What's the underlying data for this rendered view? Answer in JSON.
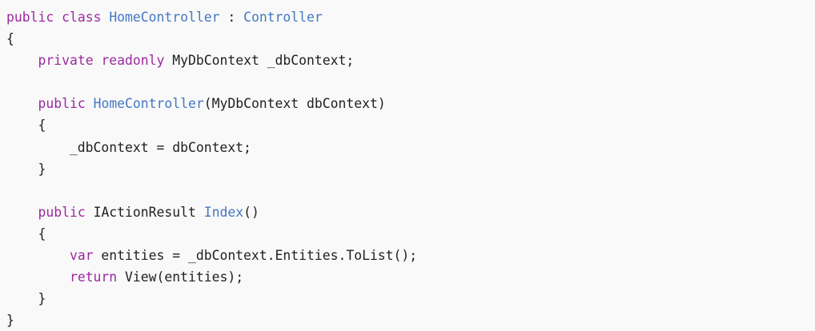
{
  "code": {
    "language": "csharp",
    "colors": {
      "background": "#f9f9f9",
      "keyword": "#9a2a9f",
      "type": "#4477c4",
      "function": "#4477c4",
      "plain": "#1f1f1f"
    },
    "lines": [
      [
        {
          "t": "public",
          "k": "kw"
        },
        {
          "t": " ",
          "k": "plain"
        },
        {
          "t": "class",
          "k": "kw"
        },
        {
          "t": " ",
          "k": "plain"
        },
        {
          "t": "HomeController",
          "k": "type"
        },
        {
          "t": " : ",
          "k": "plain"
        },
        {
          "t": "Controller",
          "k": "type"
        }
      ],
      [
        {
          "t": "{",
          "k": "plain"
        }
      ],
      [
        {
          "t": "    ",
          "k": "plain"
        },
        {
          "t": "private",
          "k": "kw"
        },
        {
          "t": " ",
          "k": "plain"
        },
        {
          "t": "readonly",
          "k": "kw"
        },
        {
          "t": " MyDbContext _dbContext;",
          "k": "plain"
        }
      ],
      [],
      [
        {
          "t": "    ",
          "k": "plain"
        },
        {
          "t": "public",
          "k": "kw"
        },
        {
          "t": " ",
          "k": "plain"
        },
        {
          "t": "HomeController",
          "k": "fn"
        },
        {
          "t": "(MyDbContext dbContext)",
          "k": "plain"
        }
      ],
      [
        {
          "t": "    {",
          "k": "plain"
        }
      ],
      [
        {
          "t": "        _dbContext = dbContext;",
          "k": "plain"
        }
      ],
      [
        {
          "t": "    }",
          "k": "plain"
        }
      ],
      [],
      [
        {
          "t": "    ",
          "k": "plain"
        },
        {
          "t": "public",
          "k": "kw"
        },
        {
          "t": " IActionResult ",
          "k": "plain"
        },
        {
          "t": "Index",
          "k": "fn"
        },
        {
          "t": "()",
          "k": "plain"
        }
      ],
      [
        {
          "t": "    {",
          "k": "plain"
        }
      ],
      [
        {
          "t": "        ",
          "k": "plain"
        },
        {
          "t": "var",
          "k": "kw"
        },
        {
          "t": " entities = _dbContext.Entities.ToList();",
          "k": "plain"
        }
      ],
      [
        {
          "t": "        ",
          "k": "plain"
        },
        {
          "t": "return",
          "k": "kw"
        },
        {
          "t": " View(entities);",
          "k": "plain"
        }
      ],
      [
        {
          "t": "    }",
          "k": "plain"
        }
      ],
      [
        {
          "t": "}",
          "k": "plain"
        }
      ]
    ]
  }
}
